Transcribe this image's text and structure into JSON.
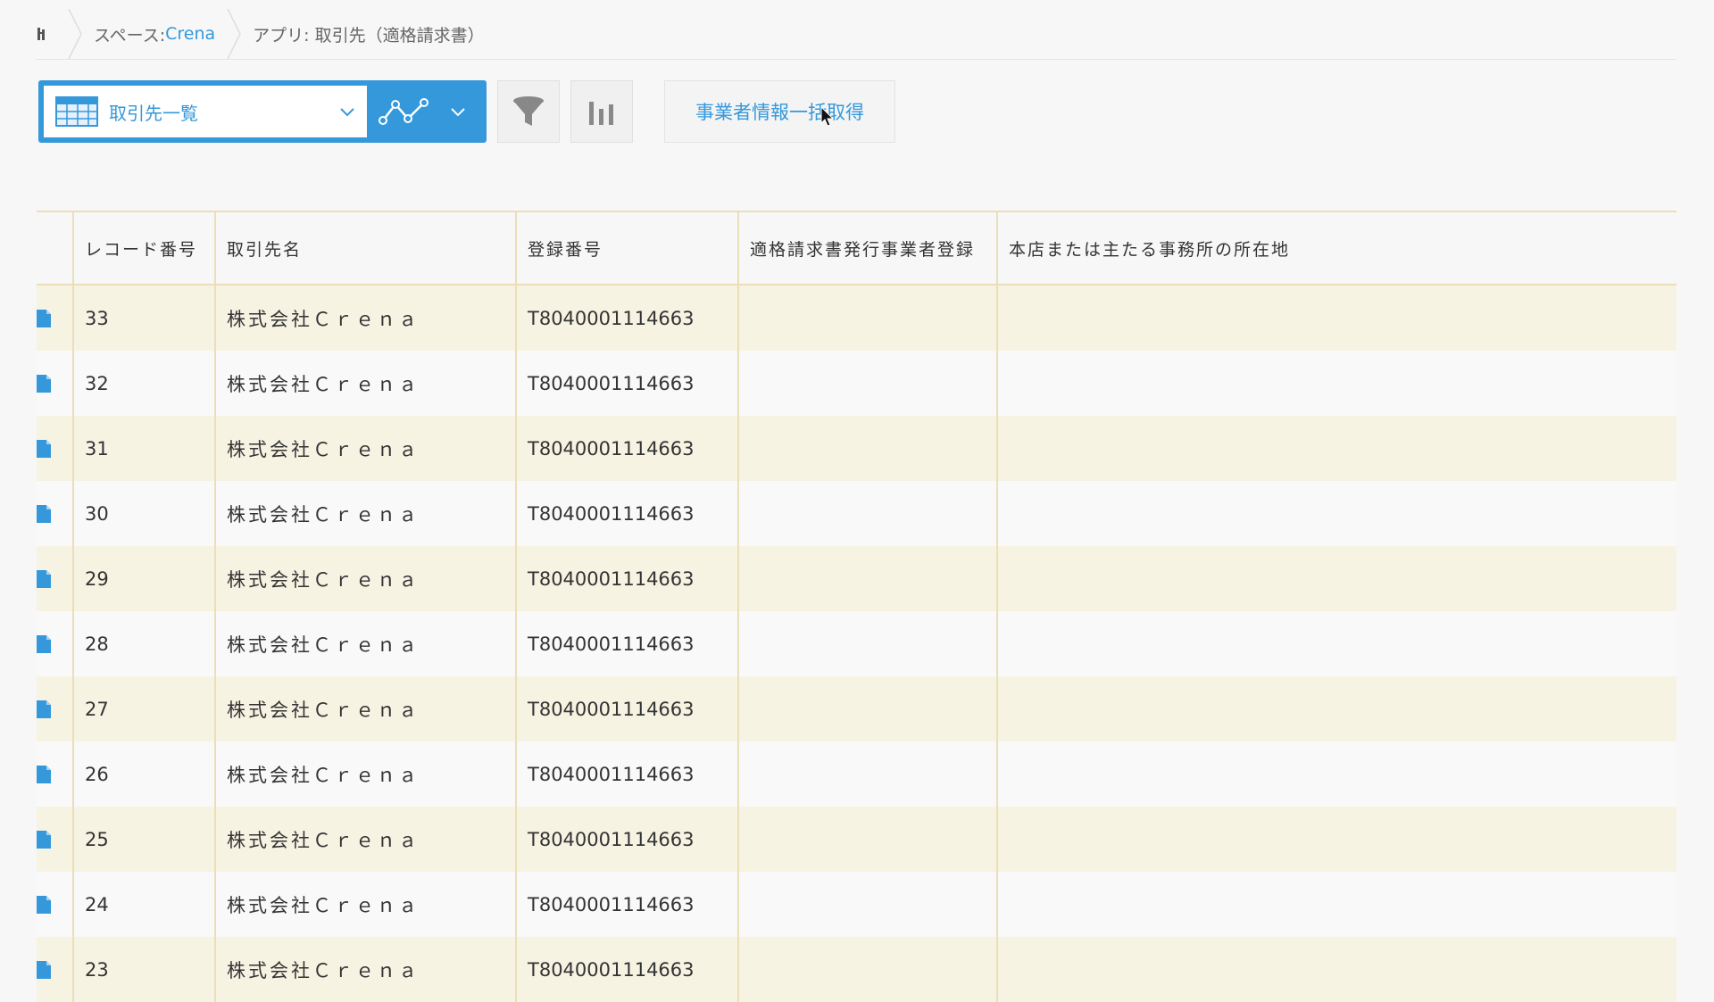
{
  "breadcrumb": {
    "space_prefix": "スペース: ",
    "space_name": "Crena",
    "app": "アプリ: 取引先（適格請求書）"
  },
  "toolbar": {
    "view_label": "取引先一覧",
    "action_label": "事業者情報一括取得"
  },
  "table": {
    "headers": [
      "",
      "レコード番号",
      "取引先名",
      "登録番号",
      "適格請求書発行事業者登録",
      "本店または主たる事務所の所在地"
    ],
    "rows": [
      {
        "id": "33",
        "name": "株式会社Ｃｒｅｎａ",
        "reg": "T8040001114663",
        "invoice": "",
        "address": ""
      },
      {
        "id": "32",
        "name": "株式会社Ｃｒｅｎａ",
        "reg": "T8040001114663",
        "invoice": "",
        "address": ""
      },
      {
        "id": "31",
        "name": "株式会社Ｃｒｅｎａ",
        "reg": "T8040001114663",
        "invoice": "",
        "address": ""
      },
      {
        "id": "30",
        "name": "株式会社Ｃｒｅｎａ",
        "reg": "T8040001114663",
        "invoice": "",
        "address": ""
      },
      {
        "id": "29",
        "name": "株式会社Ｃｒｅｎａ",
        "reg": "T8040001114663",
        "invoice": "",
        "address": ""
      },
      {
        "id": "28",
        "name": "株式会社Ｃｒｅｎａ",
        "reg": "T8040001114663",
        "invoice": "",
        "address": ""
      },
      {
        "id": "27",
        "name": "株式会社Ｃｒｅｎａ",
        "reg": "T8040001114663",
        "invoice": "",
        "address": ""
      },
      {
        "id": "26",
        "name": "株式会社Ｃｒｅｎａ",
        "reg": "T8040001114663",
        "invoice": "",
        "address": ""
      },
      {
        "id": "25",
        "name": "株式会社Ｃｒｅｎａ",
        "reg": "T8040001114663",
        "invoice": "",
        "address": ""
      },
      {
        "id": "24",
        "name": "株式会社Ｃｒｅｎａ",
        "reg": "T8040001114663",
        "invoice": "",
        "address": ""
      },
      {
        "id": "23",
        "name": "株式会社Ｃｒｅｎａ",
        "reg": "T8040001114663",
        "invoice": "",
        "address": ""
      }
    ]
  },
  "colors": {
    "accent": "#3498db",
    "row_highlight": "#f7f3e3",
    "border": "#eadfb8"
  }
}
